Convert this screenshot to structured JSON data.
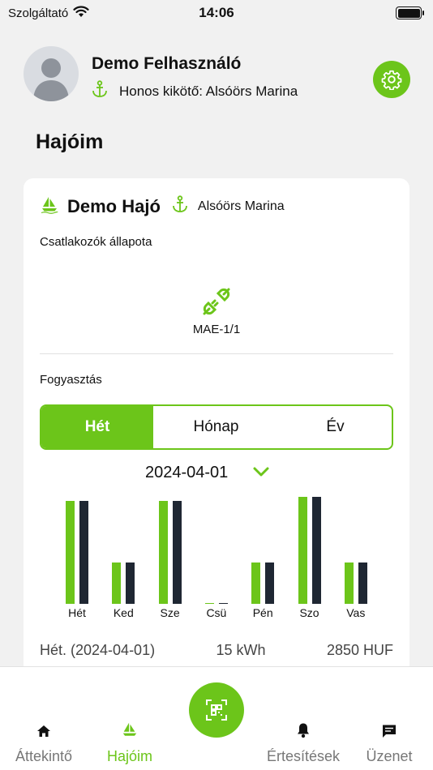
{
  "status_bar": {
    "carrier": "Szolgáltató",
    "time": "14:06"
  },
  "profile": {
    "name": "Demo Felhasználó",
    "home_port": "Honos kikötő: Alsóörs Marina"
  },
  "section_title": "Hajóim",
  "boat": {
    "name": "Demo Hajó",
    "port": "Alsóörs Marina",
    "connectors_label": "Csatlakozók állapota",
    "connector_name": "MAE-1/1",
    "consumption_label": "Fogyasztás"
  },
  "period_tabs": {
    "week": "Hét",
    "month": "Hónap",
    "year": "Év",
    "selected": "Hét"
  },
  "selected_date": "2024-04-01",
  "chart_data": {
    "type": "bar",
    "categories": [
      "Hét",
      "Ked",
      "Sze",
      "Csü",
      "Pén",
      "Szo",
      "Vas"
    ],
    "series": [
      {
        "values": [
          100,
          40,
          100,
          1,
          40,
          104,
          40
        ],
        "color": "#6cc51a"
      },
      {
        "values": [
          100,
          40,
          100,
          1,
          40,
          104,
          40
        ],
        "color": "#1f2733"
      }
    ],
    "ylim": [
      0,
      110
    ],
    "grid": false
  },
  "summary": {
    "period": "Hét. (2024-04-01)",
    "energy": "15 kWh",
    "cost": "2850 HUF"
  },
  "tab_bar": {
    "overview": "Áttekintő",
    "boats": "Hajóim",
    "notifications": "Értesítések",
    "messages": "Üzenet"
  },
  "colors": {
    "accent": "#6cc51a",
    "dark_bar": "#1f2733",
    "background": "#f1f1f1"
  }
}
